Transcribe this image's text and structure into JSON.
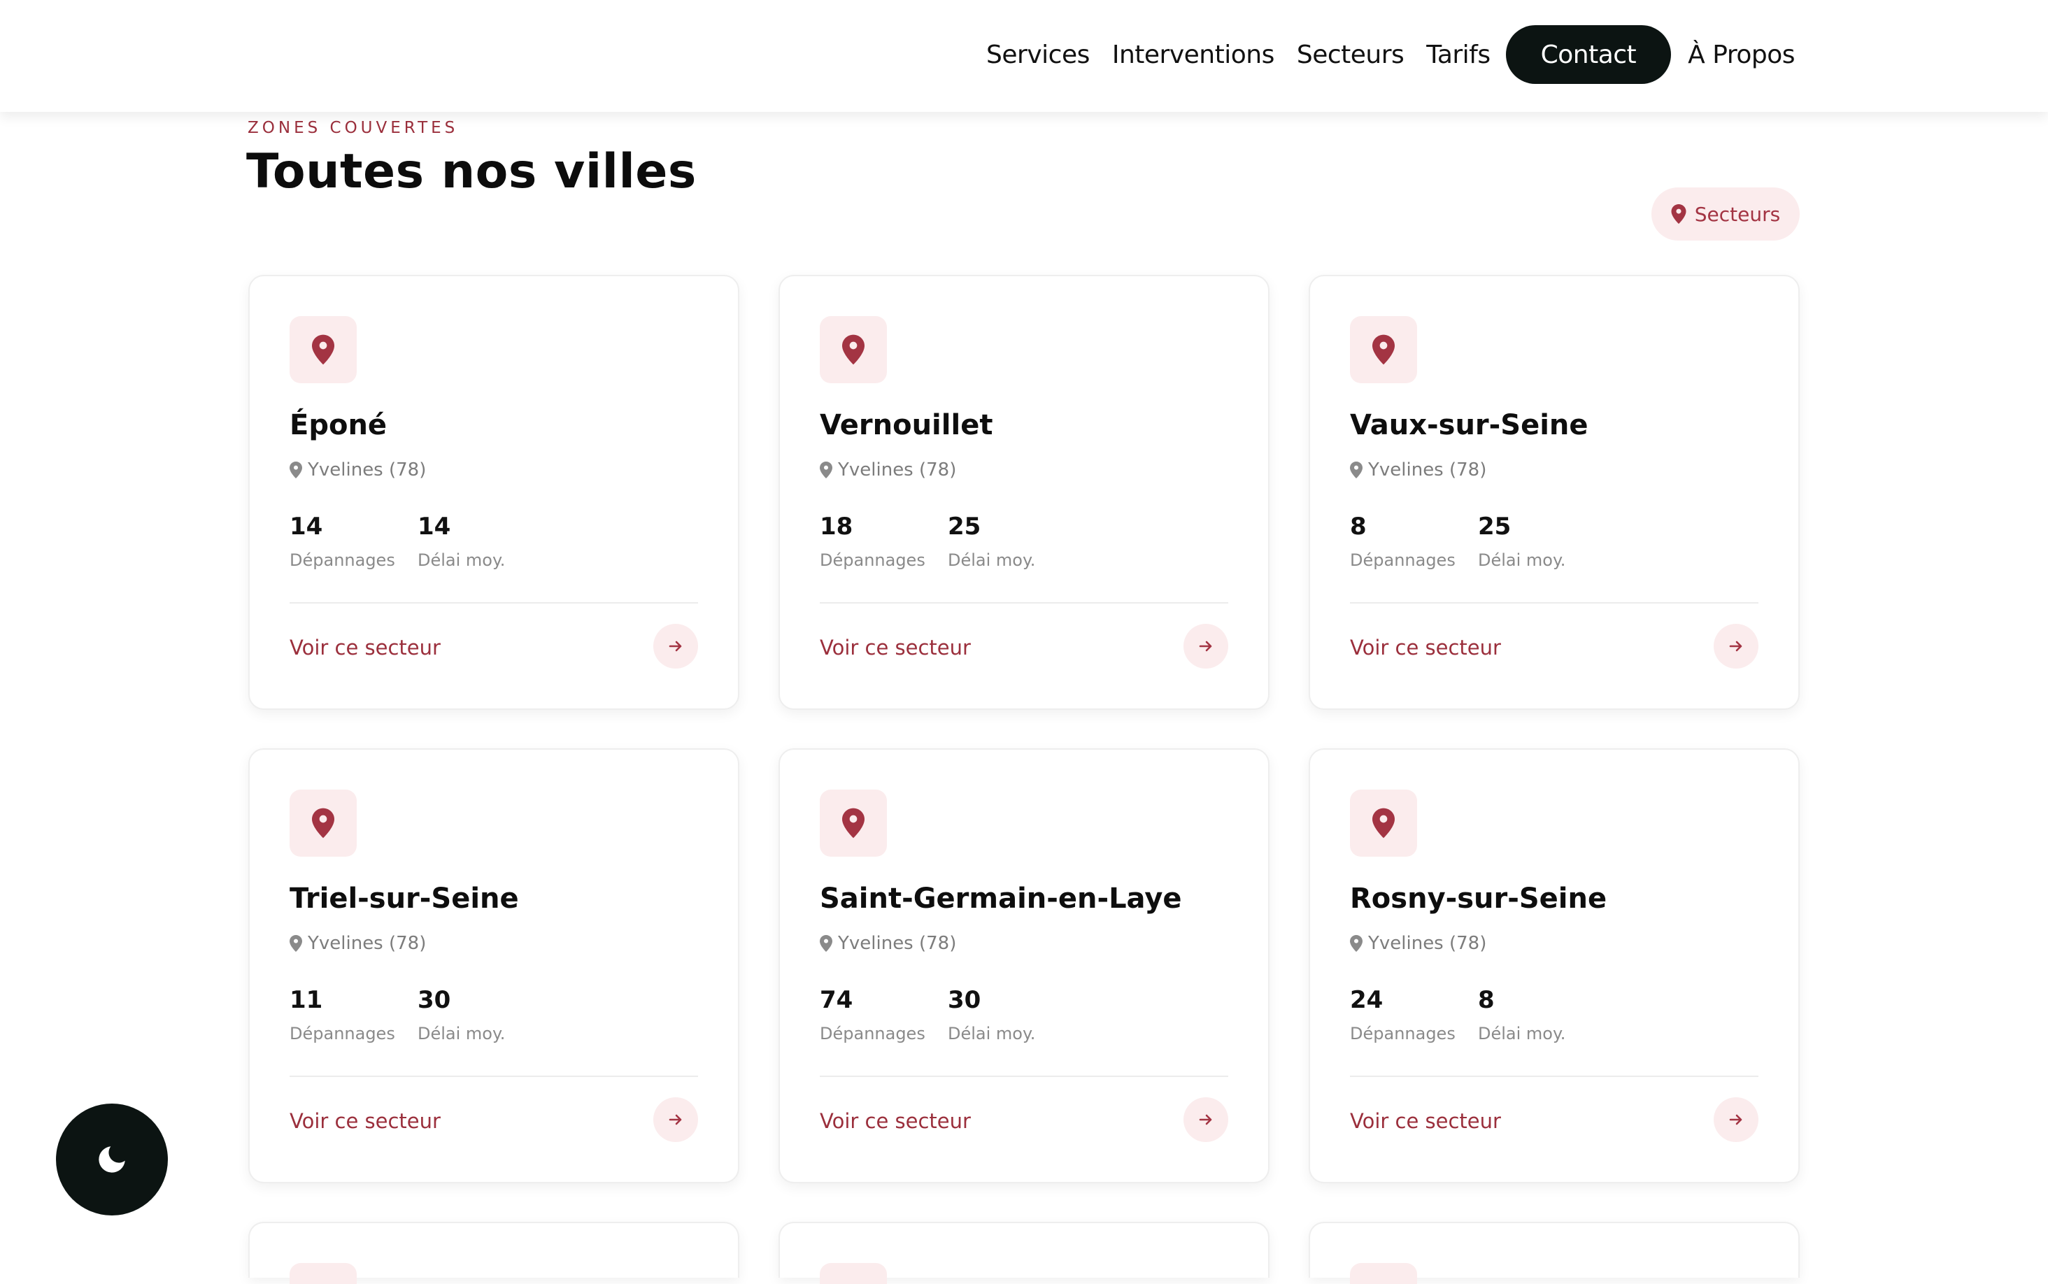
{
  "nav": {
    "items": [
      "Services",
      "Interventions",
      "Secteurs",
      "Tarifs"
    ],
    "contact_label": "Contact",
    "about_label": "À Propos"
  },
  "section": {
    "eyebrow": "Zones couvertes",
    "title": "Toutes nos villes",
    "filter_label": "Secteurs"
  },
  "card_labels": {
    "stat1_label": "Dépannages",
    "stat2_label": "Délai moy.",
    "link_label": "Voir ce secteur"
  },
  "cards": [
    {
      "city": "Époné",
      "region": "Yvelines (78)",
      "depannages": "14",
      "delai": "14"
    },
    {
      "city": "Vernouillet",
      "region": "Yvelines (78)",
      "depannages": "18",
      "delai": "25"
    },
    {
      "city": "Vaux-sur-Seine",
      "region": "Yvelines (78)",
      "depannages": "8",
      "delai": "25"
    },
    {
      "city": "Triel-sur-Seine",
      "region": "Yvelines (78)",
      "depannages": "11",
      "delai": "30"
    },
    {
      "city": "Saint-Germain-en-Laye",
      "region": "Yvelines (78)",
      "depannages": "74",
      "delai": "30"
    },
    {
      "city": "Rosny-sur-Seine",
      "region": "Yvelines (78)",
      "depannages": "24",
      "delai": "8"
    }
  ],
  "colors": {
    "accent": "#9b2f3c",
    "accent_soft": "#fbeced",
    "dark": "#0c1412"
  },
  "icons": {
    "card": "map-pin-icon",
    "link": "arrow-right-icon",
    "theme": "moon-icon"
  }
}
